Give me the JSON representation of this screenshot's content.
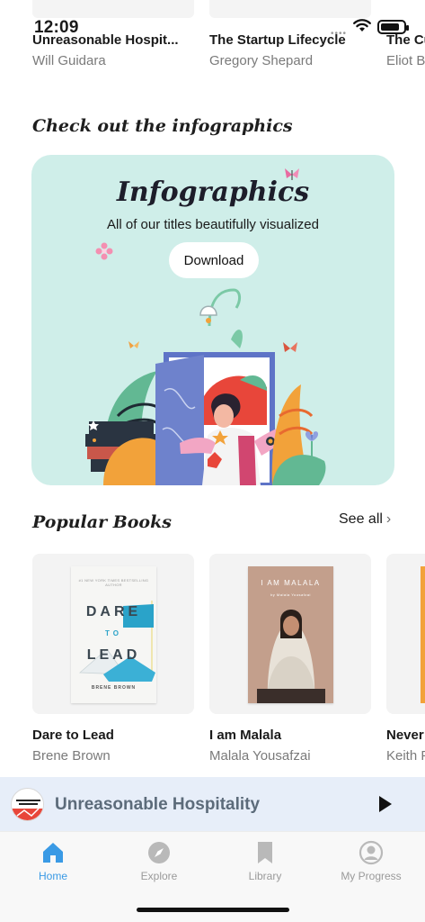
{
  "status_bar": {
    "time": "12:09",
    "dots": "••••"
  },
  "top_books": [
    {
      "title": "Unreasonable Hospit...",
      "author": "Will Guidara"
    },
    {
      "title": "The Startup Lifecycle",
      "author": "Gregory Shepard"
    },
    {
      "title": "The Cu",
      "author": "Eliot Br"
    }
  ],
  "infographics_section": {
    "heading": "Check out the infographics",
    "card_title": "Infographics",
    "card_subtitle": "All of our titles beautifully visualized",
    "download_label": "Download"
  },
  "popular_section": {
    "heading": "Popular Books",
    "see_all_label": "See all",
    "books": [
      {
        "title": "Dare to Lead",
        "author": "Brene Brown",
        "cover": {
          "top_line": "#1 NEW YORK TIMES BESTSELLING AUTHOR",
          "word1": "DARE",
          "word2": "TO",
          "word3": "LEAD",
          "author": "BRENE BROWN"
        }
      },
      {
        "title": "I am Malala",
        "author": "Malala Yousafzai",
        "cover": {
          "title": "I AM MALALA",
          "byline": "by Malala Yousafzai"
        }
      },
      {
        "title": "Never",
        "author": "Keith F"
      }
    ]
  },
  "mini_player": {
    "title": "Unreasonable Hospitality",
    "cover_text": "UNREASONABLE HOSPITALITY"
  },
  "tabs": [
    {
      "label": "Home",
      "icon": "home-icon",
      "active": true
    },
    {
      "label": "Explore",
      "icon": "compass-icon",
      "active": false
    },
    {
      "label": "Library",
      "icon": "bookmark-icon",
      "active": false
    },
    {
      "label": "My Progress",
      "icon": "profile-icon",
      "active": false
    }
  ],
  "colors": {
    "accent": "#3a9ae5",
    "card_bg": "#cfeee9",
    "player_bg": "#e7eef9"
  }
}
